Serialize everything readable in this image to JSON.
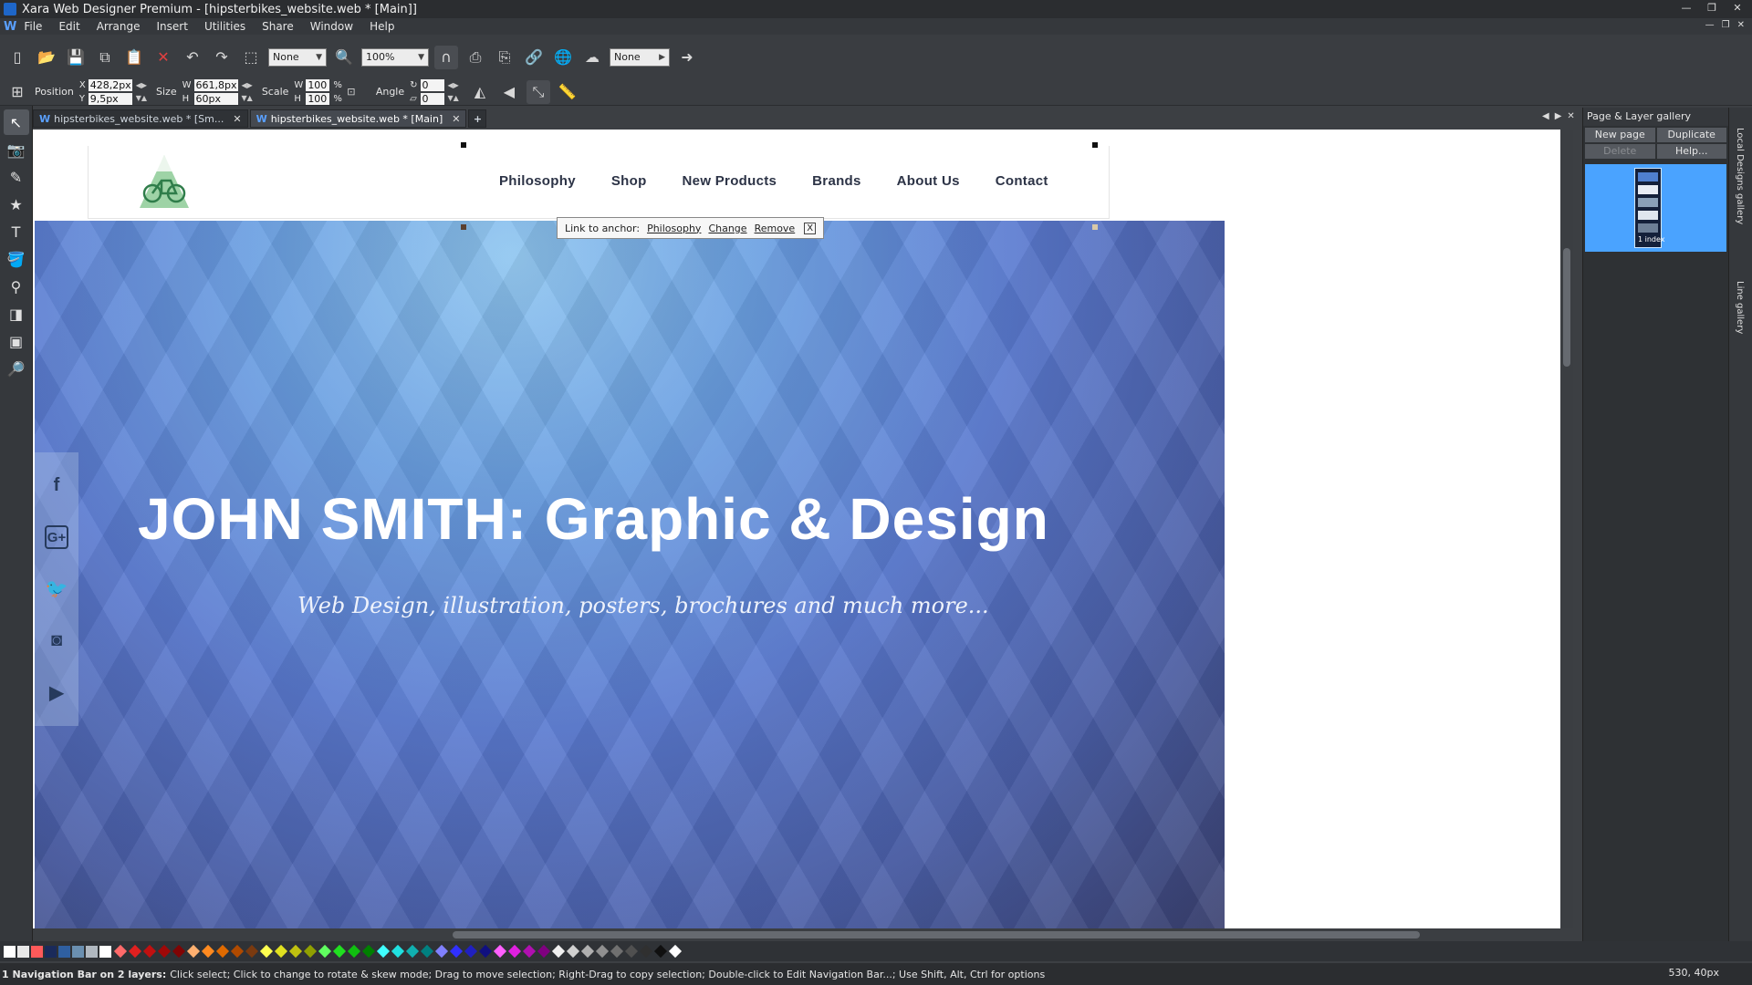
{
  "window": {
    "title": "Xara Web Designer Premium - [hipsterbikes_website.web * [Main]]"
  },
  "menu": {
    "logo": "W",
    "items": [
      "File",
      "Edit",
      "Arrange",
      "Insert",
      "Utilities",
      "Share",
      "Window",
      "Help"
    ]
  },
  "toolbar": {
    "combo1": "None",
    "zoom": "100%",
    "combo3": "None",
    "position_label": "Position",
    "x_label": "X",
    "y_label": "Y",
    "x_value": "428,2px",
    "y_value": "9,5px",
    "size_label": "Size",
    "w_label": "W",
    "h_label": "H",
    "w_value": "661,8px",
    "h_value": "60px",
    "scale_label": "Scale",
    "scale_w": "100",
    "scale_h": "100",
    "pct": "%",
    "angle_label": "Angle",
    "angle_value": "0",
    "skew_value": "0"
  },
  "tabs": [
    {
      "label": "hipsterbikes_website.web * [Sm..."
    },
    {
      "label": "hipsterbikes_website.web * [Main]"
    }
  ],
  "tab_add": "+",
  "website": {
    "nav": [
      "Philosophy",
      "Shop",
      "New Products",
      "Brands",
      "About Us",
      "Contact"
    ],
    "anchor_popup": {
      "label": "Link to anchor:",
      "link": "Philosophy",
      "change": "Change",
      "remove": "Remove",
      "close": "X"
    },
    "hero_title": "JOHN SMITH: Graphic & Design",
    "hero_subtitle": "Web Design, illustration, posters, brochures and much more...",
    "social": [
      {
        "icon": "facebook-icon",
        "glyph": "f"
      },
      {
        "icon": "google-plus-icon",
        "glyph": "G+"
      },
      {
        "icon": "twitter-icon",
        "glyph": "🐦"
      },
      {
        "icon": "instagram-icon",
        "glyph": "◙"
      },
      {
        "icon": "youtube-icon",
        "glyph": "▶"
      }
    ]
  },
  "gallery": {
    "title": "Page & Layer gallery",
    "buttons": [
      "New page",
      "Duplicate",
      "Delete",
      "Help..."
    ],
    "thumb_label": "1 index",
    "side_labels": [
      "Local Designs gallery",
      "Line gallery"
    ]
  },
  "status": {
    "bold": "1 Navigation Bar on 2 layers:",
    "text": "Click select; Click to change to rotate & skew mode; Drag to move selection; Right-Drag to copy selection; Double-click to Edit Navigation Bar...; Use Shift, Alt, Ctrl for options",
    "coords": "530, 40px"
  },
  "colors": {
    "accent": "#4aa3ff",
    "hero_top": "#8fc6f0",
    "hero_bottom": "#3a4170",
    "nav_text": "#2c3346"
  }
}
